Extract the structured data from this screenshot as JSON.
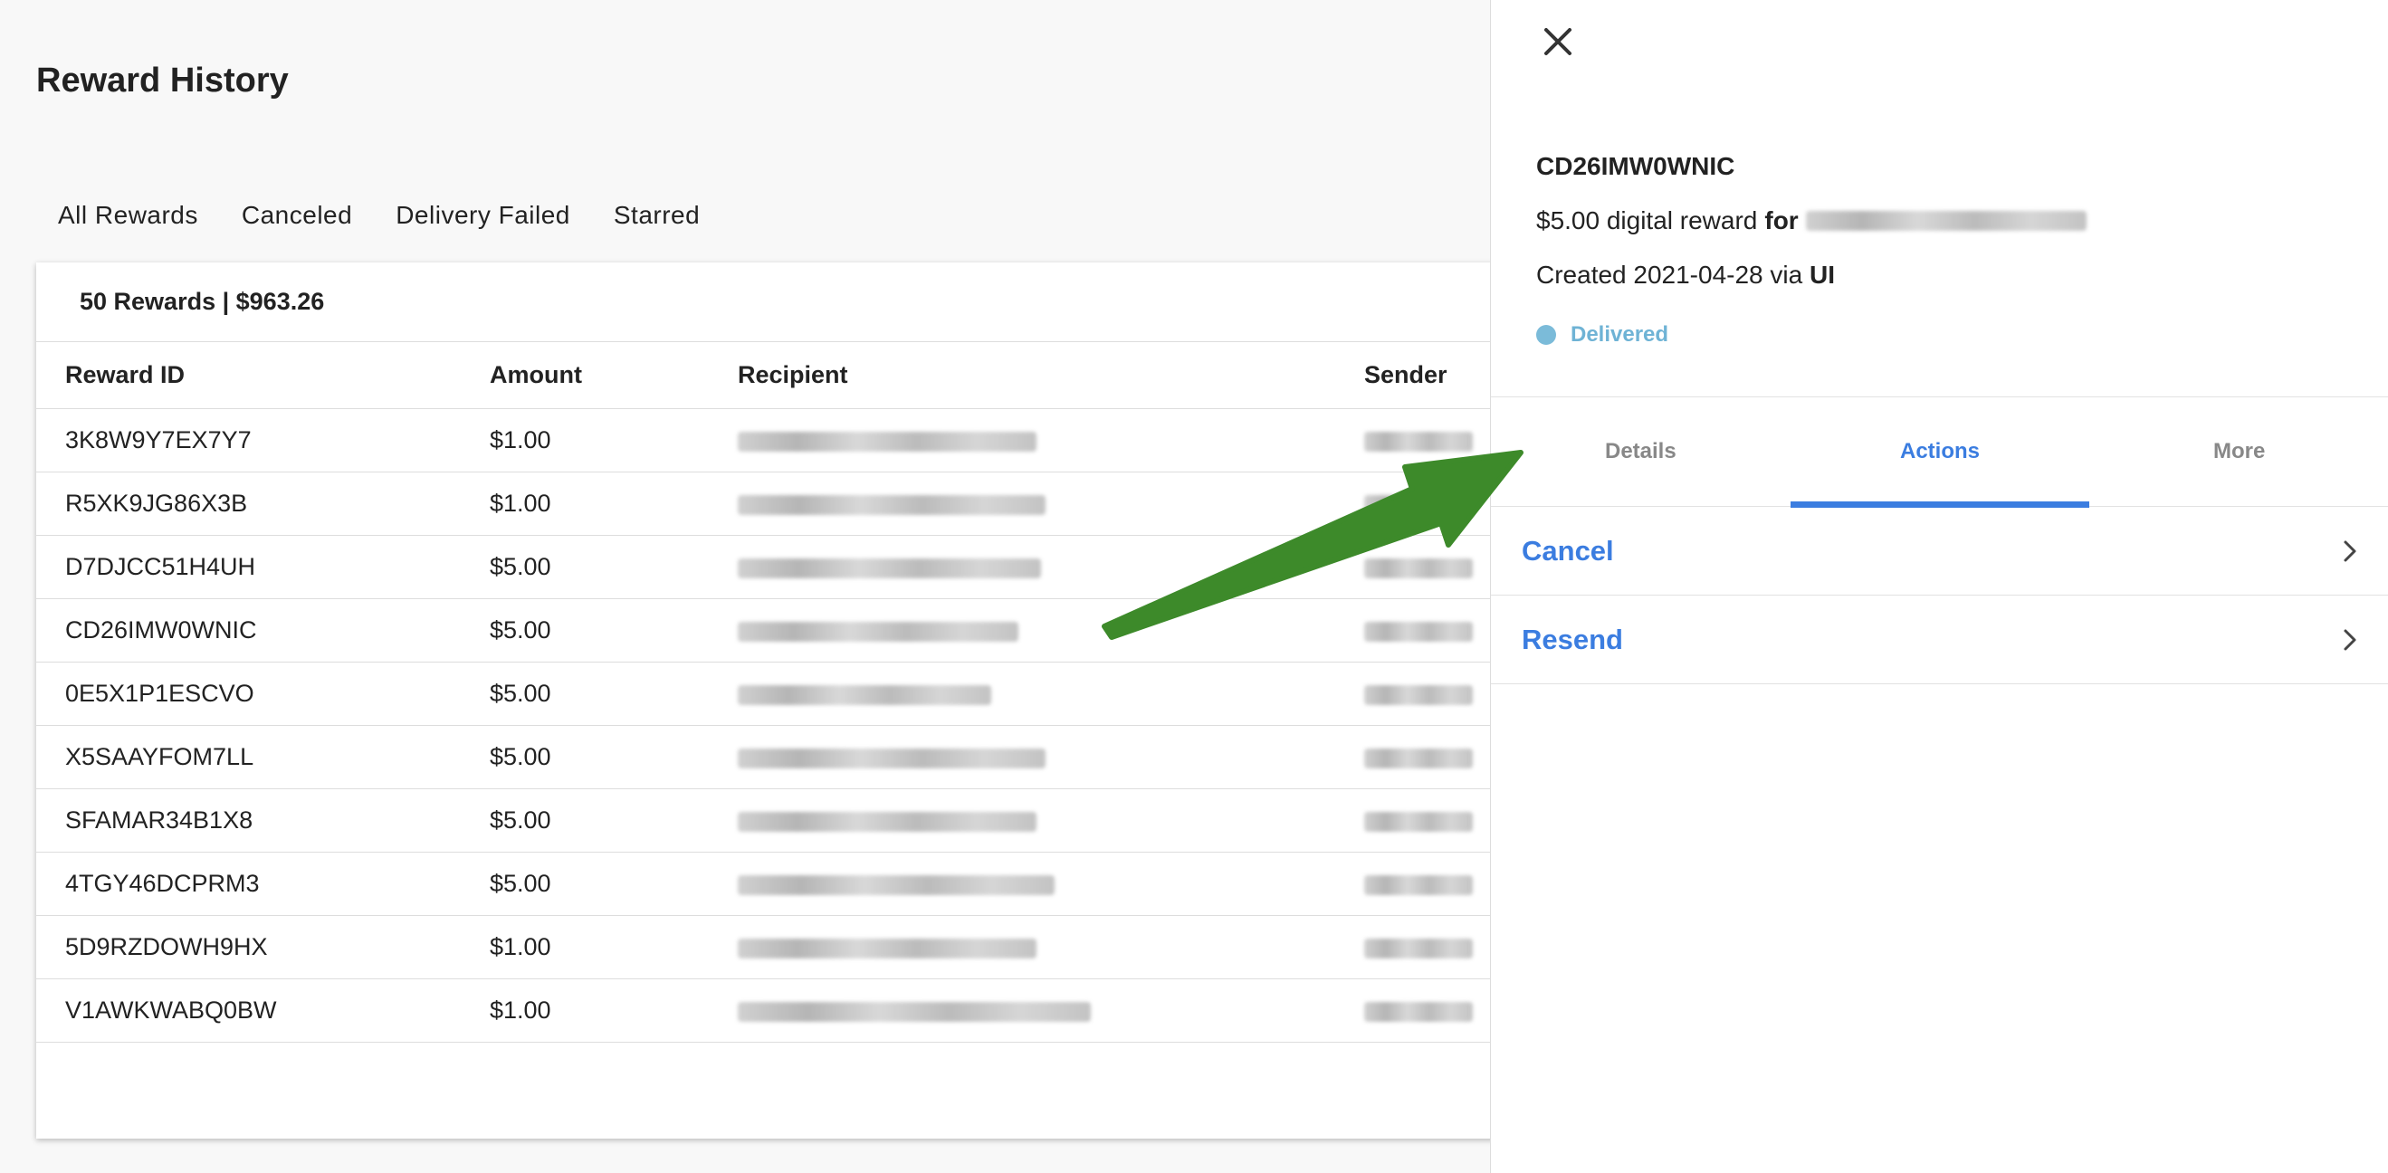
{
  "page": {
    "title": "Reward History"
  },
  "tabs": [
    {
      "label": "All Rewards"
    },
    {
      "label": "Canceled"
    },
    {
      "label": "Delivery Failed"
    },
    {
      "label": "Starred"
    }
  ],
  "summary": "50 Rewards | $963.26",
  "table": {
    "headers": {
      "id": "Reward ID",
      "amount": "Amount",
      "recipient": "Recipient",
      "sender": "Sender"
    },
    "rows": [
      {
        "id": "3K8W9Y7EX7Y7",
        "amount": "$1.00"
      },
      {
        "id": "R5XK9JG86X3B",
        "amount": "$1.00"
      },
      {
        "id": "D7DJCC51H4UH",
        "amount": "$5.00"
      },
      {
        "id": "CD26IMW0WNIC",
        "amount": "$5.00"
      },
      {
        "id": "0E5X1P1ESCVO",
        "amount": "$5.00"
      },
      {
        "id": "X5SAAYFOM7LL",
        "amount": "$5.00"
      },
      {
        "id": "SFAMAR34B1X8",
        "amount": "$5.00"
      },
      {
        "id": "4TGY46DCPRM3",
        "amount": "$5.00"
      },
      {
        "id": "5D9RZDOWH9HX",
        "amount": "$1.00"
      },
      {
        "id": "V1AWKWABQ0BW",
        "amount": "$1.00"
      }
    ]
  },
  "panel": {
    "reward_id": "CD26IMW0WNIC",
    "desc_prefix": "$5.00 digital reward",
    "desc_for": "for",
    "created_prefix": "Created 2021-04-28 via",
    "created_via": "UI",
    "status": "Delivered",
    "status_color": "#7bbbd9",
    "tabs": [
      {
        "label": "Details"
      },
      {
        "label": "Actions"
      },
      {
        "label": "More"
      }
    ],
    "active_tab": "Actions",
    "actions": [
      {
        "label": "Cancel"
      },
      {
        "label": "Resend"
      }
    ]
  },
  "colors": {
    "accent": "#3b7de0",
    "arrow": "#3d8a2a"
  }
}
